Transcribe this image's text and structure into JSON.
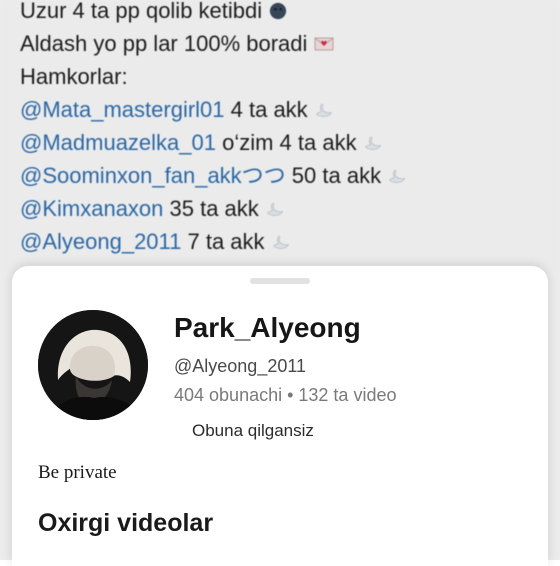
{
  "post": {
    "lines": [
      {
        "text": "Uzur 4 ta pp qolib ketibdi",
        "emoji": "new-moon-face-emoji"
      },
      {
        "text": "Aldash yo pp lar 100% boradi",
        "emoji": "love-letter-emoji"
      },
      {
        "text": "Hamkorlar:"
      },
      {
        "mention": "@Mata_mastergirl01",
        "text": " 4 ta akk",
        "emoji": "swan-emoji"
      },
      {
        "mention": "@Madmuazelka_01",
        "text": " o‘zim 4 ta akk",
        "emoji": "swan-emoji"
      },
      {
        "mention": "@Soominxon_fan_akkつつ",
        "text": " 50 ta akk",
        "emoji": "swan-emoji"
      },
      {
        "mention": "@Kimxanaxon",
        "text": " 35 ta akk",
        "emoji": "swan-emoji"
      },
      {
        "mention": "@Alyeong_2011",
        "text": " 7 ta akk",
        "emoji": "swan-emoji"
      }
    ]
  },
  "profile_sheet": {
    "username": "Park_Alyeong",
    "handle": "@Alyeong_2011",
    "stats": "404 obunachi • 132 ta video",
    "subscribed_status": "Obuna qilgansiz",
    "bio": "Be private",
    "section_title": "Oxirgi videolar",
    "avatar": "profile-avatar"
  }
}
